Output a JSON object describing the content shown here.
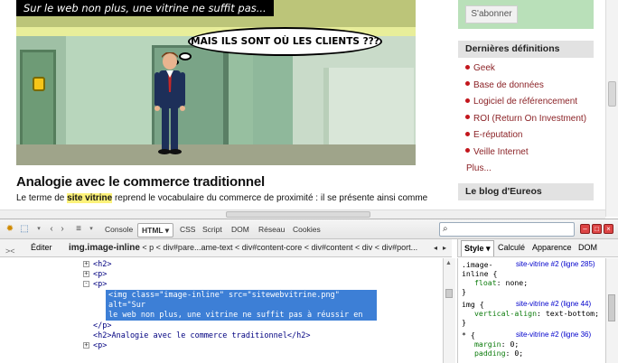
{
  "hero": {
    "caption": "Sur le web non plus, une vitrine ne suffit pas...",
    "bubble": "MAIS ILS SONT OÙ  LES CLIENTS ???"
  },
  "article": {
    "title": "Analogie avec le commerce traditionnel",
    "text_before": "Le terme de ",
    "text_highlight": "site vitrine",
    "text_after": " reprend le vocabulaire du commerce de proximité : il se présente ainsi comme"
  },
  "sidebar": {
    "subscribe_label": "S'abonner",
    "definitions_title": "Dernières définitions",
    "definitions": [
      "Geek",
      "Base de données",
      "Logiciel de référencement",
      "ROI (Return On Investment)",
      "E-réputation",
      "Veille Internet"
    ],
    "more_label": "Plus...",
    "blog_title": "Le blog d'Eureos"
  },
  "devtools": {
    "tabs": {
      "console": "Console",
      "html": "HTML ▾",
      "css": "CSS",
      "script": "Script",
      "dom": "DOM",
      "network": "Réseau",
      "cookies": "Cookies"
    },
    "search_placeholder": "",
    "edit_label": "Éditer",
    "breadcrumb_current": "img.image-inline",
    "breadcrumb_rest": " < p < div#pare...ame-text < div#content-core < div#content < div < div#port...",
    "side_tabs": {
      "style": "Style ▾",
      "computed": "Calculé",
      "layout": "Apparence",
      "dom": "DOM"
    },
    "tree": [
      {
        "sign": "+",
        "text": "<h2>"
      },
      {
        "sign": "+",
        "text": "<p>"
      },
      {
        "sign": "-",
        "text": "<p>"
      }
    ],
    "selected_node": "<img class=\"image-inline\" src=\"sitewebvitrine.png\" alt=\"Sur\nle web non plus, une vitrine ne suffit pas à réussir en\naffaires.\">",
    "tree_after": [
      {
        "sign": "",
        "text": "</p>"
      },
      {
        "sign": "",
        "text": "<h2>Analogie avec le commerce traditionnel</h2>"
      },
      {
        "sign": "+",
        "text": "<p>"
      }
    ],
    "rules": [
      {
        "selector": ".image-",
        "selector_cont": "inline {",
        "source": "site-vitrine #2 (ligne 285)",
        "prop": "float",
        "value": "none;"
      },
      {
        "selector": "img {",
        "selector_cont": "",
        "source": "site-vitrine #2 (ligne 44)",
        "prop": "vertical-align",
        "value": "text-bottom;"
      },
      {
        "selector": "* {",
        "selector_cont": "",
        "source": "site-vitrine #2 (ligne 36)",
        "prop": "margin",
        "value": "0;",
        "prop2": "padding",
        "value2": "0;"
      }
    ]
  }
}
